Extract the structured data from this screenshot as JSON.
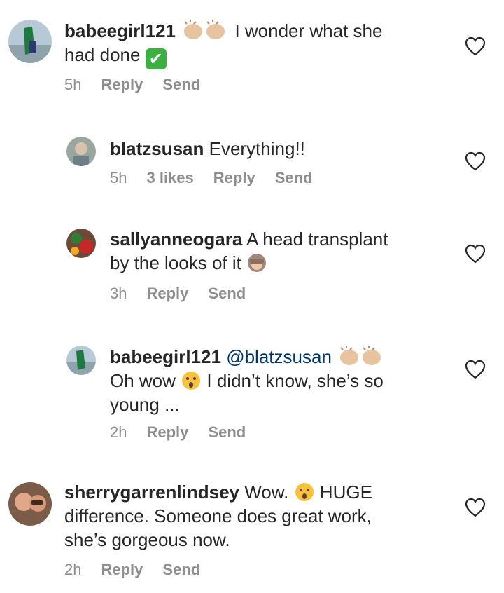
{
  "comments": [
    {
      "username": "babeegirl121",
      "text_a": " I wonder what she",
      "text_b": "had done ",
      "time": "5h",
      "reply": "Reply",
      "send": "Send"
    },
    {
      "username": "blatzsusan",
      "text_a": " Everything!!",
      "time": "5h",
      "likes": "3 likes",
      "reply": "Reply",
      "send": "Send"
    },
    {
      "username": "sallyanneogara",
      "text_a": " A head transplant",
      "text_b": "by the looks of it ",
      "time": "3h",
      "reply": "Reply",
      "send": "Send"
    },
    {
      "username": "babeegirl121",
      "mention": " @blatzsusan",
      "text_b1": "Oh wow ",
      "text_b2": " I didn’t know, she’s so",
      "text_c": "young ...",
      "time": "2h",
      "reply": "Reply",
      "send": "Send"
    },
    {
      "username": "sherrygarrenlindsey",
      "text_a1": " Wow. ",
      "text_a2": " HUGE",
      "text_b": "difference. Someone does great work,",
      "text_c": "she’s gorgeous now.",
      "time": "2h",
      "reply": "Reply",
      "send": "Send"
    }
  ],
  "icons": {
    "like": "heart-outline-icon",
    "check": "check-mark-button-emoji",
    "clap": "clapping-hands-emoji",
    "hushed": "hushed-face-emoji",
    "see_no_evil": "see-no-evil-monkey-emoji"
  },
  "check_glyph": "✔",
  "colors": {
    "text": "#262626",
    "meta": "#8e8e8e",
    "mention": "#00376b",
    "check": "#3cb043"
  }
}
